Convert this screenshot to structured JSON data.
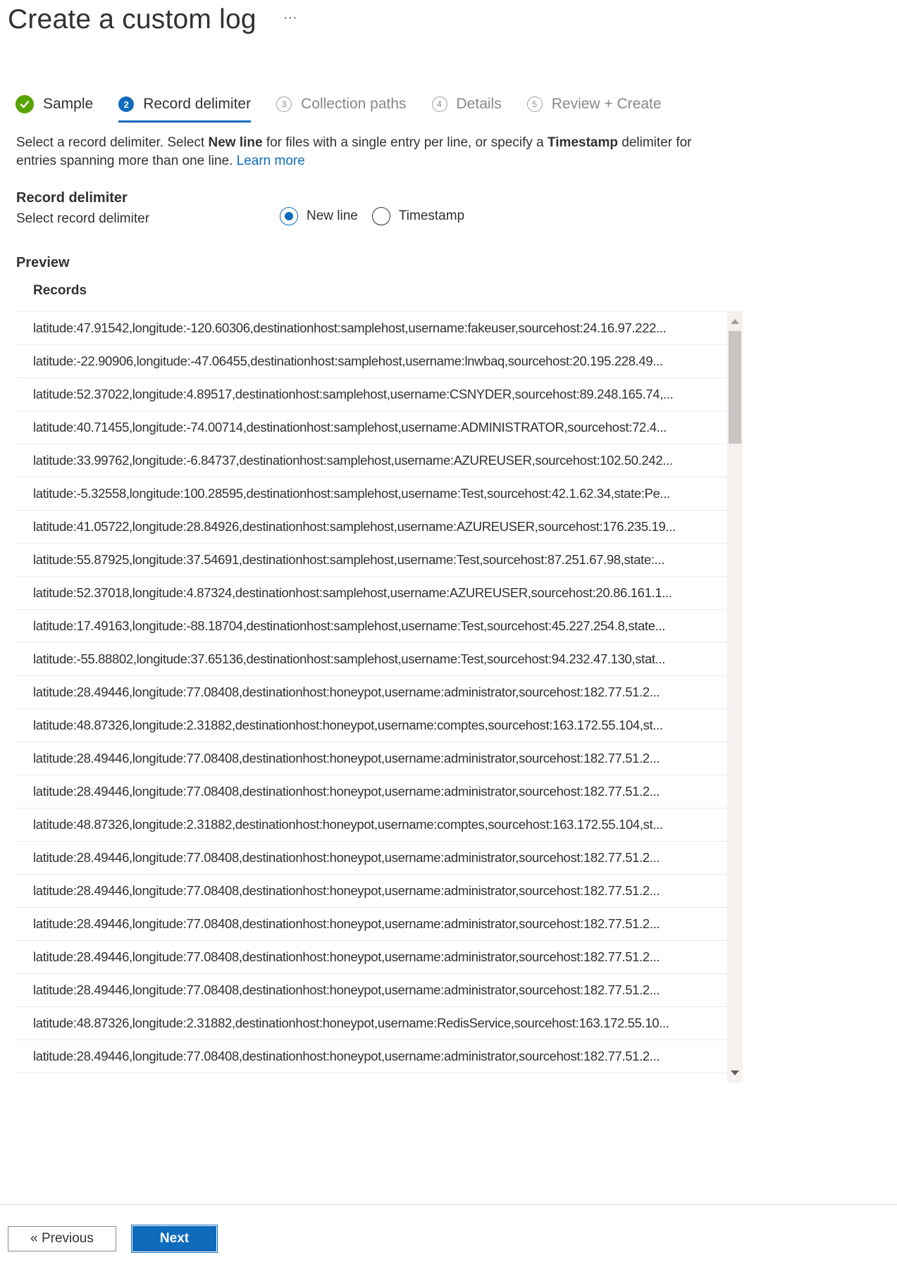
{
  "page": {
    "title": "Create a custom log",
    "more_label": "···"
  },
  "steps": [
    {
      "number": "✓",
      "label": "Sample",
      "state": "done"
    },
    {
      "number": "2",
      "label": "Record delimiter",
      "state": "active"
    },
    {
      "number": "3",
      "label": "Collection paths",
      "state": "pending"
    },
    {
      "number": "4",
      "label": "Details",
      "state": "pending"
    },
    {
      "number": "5",
      "label": "Review + Create",
      "state": "pending"
    }
  ],
  "description": {
    "part1": "Select a record delimiter. Select ",
    "bold1": "New line",
    "part2": " for files with a single entry per line, or specify a ",
    "bold2": "Timestamp",
    "part3": " delimiter for entries spanning more than one line. ",
    "link": "Learn more"
  },
  "record_delimiter": {
    "title": "Record delimiter",
    "sub_label": "Select record delimiter",
    "options": [
      {
        "label": "New line",
        "selected": true
      },
      {
        "label": "Timestamp",
        "selected": false
      }
    ]
  },
  "preview": {
    "title": "Preview",
    "column_header": "Records",
    "records": [
      "latitude:47.91542,longitude:-120.60306,destinationhost:samplehost,username:fakeuser,sourcehost:24.16.97.222...",
      "latitude:-22.90906,longitude:-47.06455,destinationhost:samplehost,username:lnwbaq,sourcehost:20.195.228.49...",
      "latitude:52.37022,longitude:4.89517,destinationhost:samplehost,username:CSNYDER,sourcehost:89.248.165.74,...",
      "latitude:40.71455,longitude:-74.00714,destinationhost:samplehost,username:ADMINISTRATOR,sourcehost:72.4...",
      "latitude:33.99762,longitude:-6.84737,destinationhost:samplehost,username:AZUREUSER,sourcehost:102.50.242...",
      "latitude:-5.32558,longitude:100.28595,destinationhost:samplehost,username:Test,sourcehost:42.1.62.34,state:Pe...",
      "latitude:41.05722,longitude:28.84926,destinationhost:samplehost,username:AZUREUSER,sourcehost:176.235.19...",
      "latitude:55.87925,longitude:37.54691,destinationhost:samplehost,username:Test,sourcehost:87.251.67.98,state:...",
      "latitude:52.37018,longitude:4.87324,destinationhost:samplehost,username:AZUREUSER,sourcehost:20.86.161.1...",
      "latitude:17.49163,longitude:-88.18704,destinationhost:samplehost,username:Test,sourcehost:45.227.254.8,state...",
      "latitude:-55.88802,longitude:37.65136,destinationhost:samplehost,username:Test,sourcehost:94.232.47.130,stat...",
      "latitude:28.49446,longitude:77.08408,destinationhost:honeypot,username:administrator,sourcehost:182.77.51.2...",
      "latitude:48.87326,longitude:2.31882,destinationhost:honeypot,username:comptes,sourcehost:163.172.55.104,st...",
      "latitude:28.49446,longitude:77.08408,destinationhost:honeypot,username:administrator,sourcehost:182.77.51.2...",
      "latitude:28.49446,longitude:77.08408,destinationhost:honeypot,username:administrator,sourcehost:182.77.51.2...",
      "latitude:48.87326,longitude:2.31882,destinationhost:honeypot,username:comptes,sourcehost:163.172.55.104,st...",
      "latitude:28.49446,longitude:77.08408,destinationhost:honeypot,username:administrator,sourcehost:182.77.51.2...",
      "latitude:28.49446,longitude:77.08408,destinationhost:honeypot,username:administrator,sourcehost:182.77.51.2...",
      "latitude:28.49446,longitude:77.08408,destinationhost:honeypot,username:administrator,sourcehost:182.77.51.2...",
      "latitude:28.49446,longitude:77.08408,destinationhost:honeypot,username:administrator,sourcehost:182.77.51.2...",
      "latitude:28.49446,longitude:77.08408,destinationhost:honeypot,username:administrator,sourcehost:182.77.51.2...",
      "latitude:48.87326,longitude:2.31882,destinationhost:honeypot,username:RedisService,sourcehost:163.172.55.10...",
      "latitude:28.49446,longitude:77.08408,destinationhost:honeypot,username:administrator,sourcehost:182.77.51.2..."
    ]
  },
  "footer": {
    "previous_label": "« Previous",
    "next_label": "Next"
  },
  "colors": {
    "accent": "#0f6cbd",
    "success": "#57a300",
    "text": "#323130",
    "muted": "#8a8886"
  }
}
